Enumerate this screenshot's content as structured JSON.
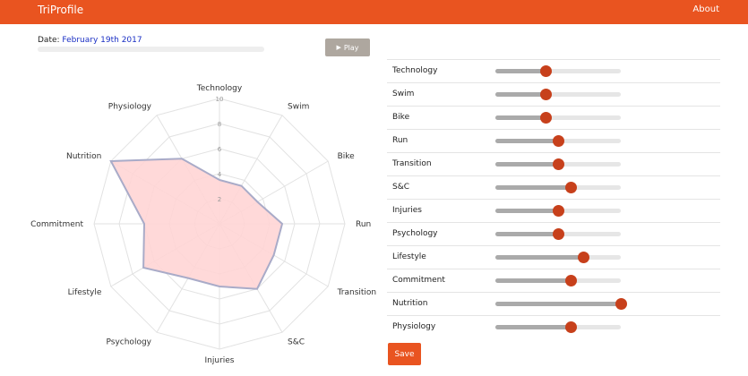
{
  "app": {
    "brand": "TriProfile",
    "nav_about": "About"
  },
  "date": {
    "label": "Date:",
    "value": "February 19th 2017",
    "progress": 0
  },
  "play_button": {
    "icon": "play-icon",
    "label": "Play"
  },
  "radar": {
    "max": 10,
    "rings": [
      2,
      4,
      6,
      8,
      10
    ],
    "ring_labels": [
      "2",
      "4",
      "6",
      "8",
      "10"
    ],
    "axes": [
      "Technology",
      "Swim",
      "Bike",
      "Run",
      "Transition",
      "S&C",
      "Injuries",
      "Psychology",
      "Lifestyle",
      "Commitment",
      "Nutrition",
      "Physiology"
    ],
    "values": [
      3.5,
      3.5,
      3.5,
      5,
      5,
      6,
      5,
      5,
      7,
      6,
      10,
      6
    ],
    "fill_color": "#ffd5d5",
    "stroke_color": "#a9abc8"
  },
  "sliders": [
    {
      "label": "Technology",
      "value": 4,
      "max": 10
    },
    {
      "label": "Swim",
      "value": 4,
      "max": 10
    },
    {
      "label": "Bike",
      "value": 4,
      "max": 10
    },
    {
      "label": "Run",
      "value": 5,
      "max": 10
    },
    {
      "label": "Transition",
      "value": 5,
      "max": 10
    },
    {
      "label": "S&C",
      "value": 6,
      "max": 10
    },
    {
      "label": "Injuries",
      "value": 5,
      "max": 10
    },
    {
      "label": "Psychology",
      "value": 5,
      "max": 10
    },
    {
      "label": "Lifestyle",
      "value": 7,
      "max": 10
    },
    {
      "label": "Commitment",
      "value": 6,
      "max": 10
    },
    {
      "label": "Nutrition",
      "value": 10,
      "max": 10
    },
    {
      "label": "Physiology",
      "value": 6,
      "max": 10
    }
  ],
  "save_button": {
    "label": "Save"
  },
  "colors": {
    "accent": "#e95420",
    "thumb": "#c7401b"
  }
}
